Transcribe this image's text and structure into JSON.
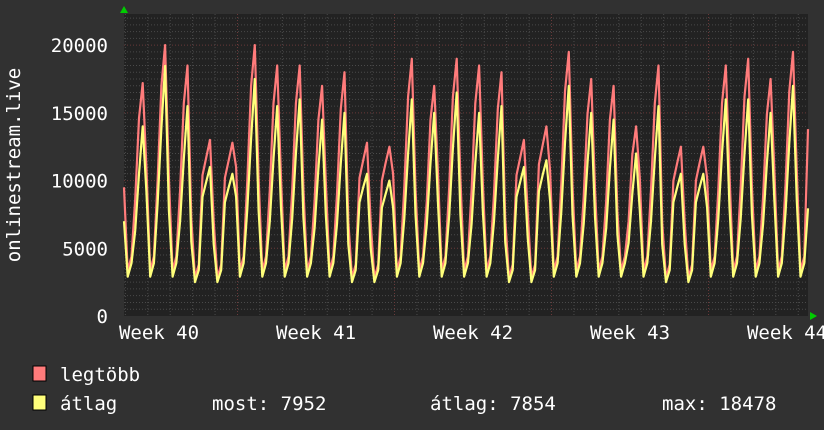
{
  "chart_data": {
    "type": "line",
    "ylabel": "onlinestream.live",
    "ylim": [
      0,
      22300
    ],
    "y_ticks": [
      0,
      5000,
      10000,
      15000,
      20000
    ],
    "x_tick_labels": [
      "Week 40",
      "Week 41",
      "Week 42",
      "Week 43",
      "Week 44"
    ],
    "grid": true,
    "legend_placement": "bottom-left",
    "background": "#222222",
    "series": [
      {
        "name": "legtöbb",
        "color": "#ff7b7b",
        "values": [
          9500,
          3300,
          4400,
          8600,
          14600,
          17200,
          11000,
          3300,
          4400,
          10000,
          17000,
          20000,
          10200,
          3300,
          4400,
          9300,
          15700,
          18500,
          7200,
          2800,
          3800,
          10400,
          11700,
          13000,
          7000,
          2800,
          3800,
          10200,
          11500,
          12800,
          11000,
          3300,
          4400,
          10000,
          17000,
          20000,
          10200,
          3300,
          4400,
          9300,
          15700,
          18500,
          10200,
          3300,
          4400,
          9300,
          15700,
          18500,
          9400,
          3300,
          4400,
          8500,
          14500,
          17000,
          9900,
          3300,
          4400,
          9000,
          15300,
          18000,
          7000,
          2800,
          3800,
          10200,
          11500,
          12800,
          6900,
          2800,
          3800,
          10000,
          11300,
          12500,
          10500,
          3300,
          4400,
          9500,
          16200,
          19000,
          9400,
          3300,
          4400,
          8500,
          14500,
          17000,
          10500,
          3300,
          4400,
          9500,
          16200,
          19000,
          10200,
          3300,
          4400,
          9300,
          15700,
          18500,
          9900,
          3300,
          4400,
          9000,
          15300,
          18000,
          7200,
          2800,
          3800,
          10400,
          11700,
          13000,
          7700,
          2800,
          3800,
          11200,
          12600,
          14000,
          10700,
          3300,
          4400,
          9800,
          16600,
          19500,
          9600,
          3300,
          4400,
          8800,
          14900,
          17500,
          9400,
          3300,
          4400,
          8500,
          14500,
          17000,
          7700,
          3300,
          4400,
          7000,
          11900,
          14000,
          10200,
          3300,
          4400,
          9300,
          15700,
          18500,
          6900,
          2800,
          3800,
          10000,
          11300,
          12500,
          6900,
          2800,
          3800,
          10000,
          11300,
          12500,
          10200,
          3300,
          4400,
          9300,
          15700,
          18500,
          10500,
          3300,
          4400,
          9500,
          16200,
          19000,
          9600,
          3300,
          4400,
          8800,
          14900,
          17500,
          10700,
          3300,
          4400,
          9800,
          16600,
          19500,
          10700,
          3300,
          4400,
          13800
        ]
      },
      {
        "name": "átlag",
        "color": "#ffff7b",
        "values": [
          7000,
          2900,
          3900,
          6300,
          10500,
          14000,
          9200,
          2900,
          3900,
          8300,
          13900,
          18478,
          7800,
          2900,
          3900,
          7000,
          11600,
          15500,
          5500,
          2500,
          3400,
          8800,
          9900,
          11000,
          5300,
          2500,
          3400,
          8400,
          9500,
          10500,
          8800,
          2900,
          3900,
          7900,
          13100,
          17500,
          7800,
          2900,
          3900,
          7000,
          11600,
          15500,
          8000,
          2900,
          3900,
          7200,
          12000,
          16000,
          7300,
          2900,
          3900,
          6500,
          10900,
          14500,
          7500,
          2900,
          3900,
          6800,
          11300,
          15000,
          5300,
          2500,
          3400,
          8400,
          9500,
          10500,
          5000,
          2500,
          3400,
          8000,
          9000,
          10000,
          8000,
          2900,
          3900,
          7200,
          12000,
          16000,
          7500,
          2900,
          3900,
          6800,
          11300,
          15000,
          8300,
          2900,
          3900,
          7400,
          12400,
          16500,
          7500,
          2900,
          3900,
          6800,
          11300,
          15000,
          7800,
          2900,
          3900,
          7000,
          11600,
          15500,
          5500,
          2500,
          3400,
          8800,
          9900,
          11000,
          5800,
          2500,
          3400,
          9200,
          10400,
          11500,
          8500,
          2900,
          3900,
          7700,
          12800,
          17000,
          7500,
          2900,
          3900,
          6800,
          11300,
          15000,
          7300,
          2900,
          3900,
          6500,
          10900,
          14500,
          6000,
          2900,
          3900,
          5400,
          9000,
          12000,
          7800,
          2900,
          3900,
          7000,
          11600,
          15500,
          5300,
          2500,
          3400,
          8400,
          9500,
          10500,
          5300,
          2500,
          3400,
          8400,
          9500,
          10500,
          8000,
          2900,
          3900,
          7200,
          12000,
          16000,
          8000,
          2900,
          3900,
          7200,
          12000,
          16000,
          7500,
          2900,
          3900,
          6800,
          11300,
          15000,
          8500,
          2900,
          3900,
          7700,
          12800,
          17000,
          8500,
          2900,
          3900,
          7952
        ]
      }
    ]
  },
  "legend": {
    "items": [
      {
        "label": "legtöbb",
        "color": "#ff7b7b"
      },
      {
        "label": "átlag",
        "color": "#ffff7b"
      }
    ],
    "stats": {
      "now": "most: 7952",
      "avg": "átlag: 7854",
      "max": "max: 18478"
    }
  }
}
